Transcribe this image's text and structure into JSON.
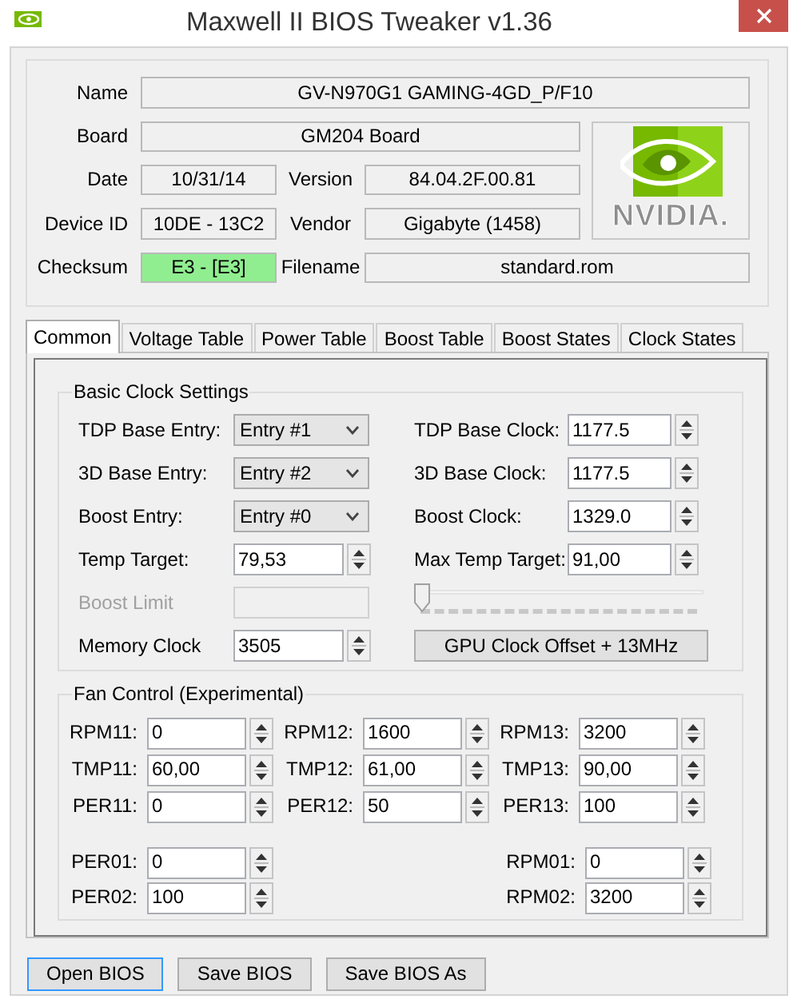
{
  "window": {
    "title": "Maxwell II BIOS Tweaker v1.36"
  },
  "info": {
    "name": {
      "label": "Name",
      "value": "GV-N970G1 GAMING-4GD_P/F10"
    },
    "board": {
      "label": "Board",
      "value": "GM204 Board"
    },
    "date": {
      "label": "Date",
      "value": "10/31/14"
    },
    "version": {
      "label": "Version",
      "value": "84.04.2F.00.81"
    },
    "device_id": {
      "label": "Device ID",
      "value": "10DE - 13C2"
    },
    "vendor": {
      "label": "Vendor",
      "value": "Gigabyte (1458)"
    },
    "checksum": {
      "label": "Checksum",
      "value": "E3 - [E3]",
      "valid": true
    },
    "filename": {
      "label": "Filename",
      "value": "standard.rom"
    },
    "logo_text": "NVIDIA."
  },
  "tabs": [
    {
      "label": "Common",
      "selected": true
    },
    {
      "label": "Voltage Table",
      "selected": false
    },
    {
      "label": "Power Table",
      "selected": false
    },
    {
      "label": "Boost Table",
      "selected": false
    },
    {
      "label": "Boost States",
      "selected": false
    },
    {
      "label": "Clock States",
      "selected": false
    }
  ],
  "basic_clock": {
    "title": "Basic Clock Settings",
    "left": [
      {
        "kind": "dropdown",
        "label": "TDP Base Entry:",
        "value": "Entry #1",
        "disabled": false
      },
      {
        "kind": "dropdown",
        "label": "3D Base Entry:",
        "value": "Entry #2",
        "disabled": false
      },
      {
        "kind": "dropdown",
        "label": "Boost Entry:",
        "value": "Entry #0",
        "disabled": false
      },
      {
        "kind": "spin",
        "label": "Temp Target:",
        "value": "79,53",
        "disabled": false
      },
      {
        "kind": "field",
        "label": "Boost Limit",
        "disabled": true
      },
      {
        "kind": "spin",
        "label": "Memory Clock",
        "value": "3505",
        "disabled": false
      }
    ],
    "right": [
      {
        "kind": "spin",
        "label": "TDP Base Clock:",
        "value": "1177.5"
      },
      {
        "kind": "spin",
        "label": "3D Base Clock:",
        "value": "1177.5"
      },
      {
        "kind": "spin",
        "label": "Boost Clock:",
        "value": "1329.0"
      },
      {
        "kind": "spin",
        "label": "Max Temp Target:",
        "value": "91,00"
      },
      {
        "kind": "slider",
        "level": 0
      },
      {
        "kind": "button",
        "label": "GPU Clock Offset + 13MHz"
      }
    ]
  },
  "fan_control": {
    "title": "Fan Control (Experimental)",
    "rows": [
      [
        {
          "label": "RPM11:",
          "value": "0"
        },
        {
          "label": "RPM12:",
          "value": "1600"
        },
        {
          "label": "RPM13:",
          "value": "3200"
        }
      ],
      [
        {
          "label": "TMP11:",
          "value": "60,00"
        },
        {
          "label": "TMP12:",
          "value": "61,00"
        },
        {
          "label": "TMP13:",
          "value": "90,00"
        }
      ],
      [
        {
          "label": "PER11:",
          "value": "0"
        },
        {
          "label": "PER12:",
          "value": "50"
        },
        {
          "label": "PER13:",
          "value": "100"
        }
      ]
    ],
    "bottom_left": [
      {
        "label": "PER01:",
        "value": "0"
      },
      {
        "label": "PER02:",
        "value": "100"
      }
    ],
    "bottom_right": [
      {
        "label": "RPM01:",
        "value": "0"
      },
      {
        "label": "RPM02:",
        "value": "3200"
      }
    ]
  },
  "buttons": [
    {
      "label": "Open BIOS",
      "default": true
    },
    {
      "label": "Save BIOS",
      "default": false
    },
    {
      "label": "Save BIOS As",
      "default": false
    }
  ]
}
